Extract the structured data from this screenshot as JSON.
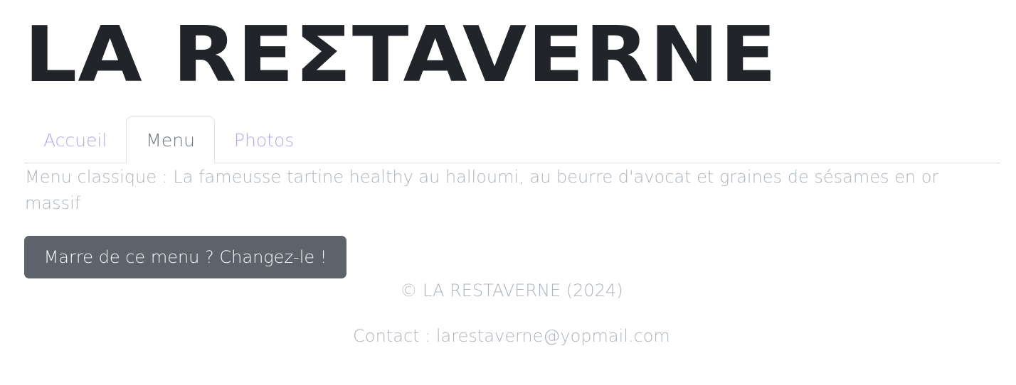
{
  "header": {
    "title": "LA REΣTAVERNE"
  },
  "tabs": [
    {
      "label": "Accueil",
      "active": false
    },
    {
      "label": "Menu",
      "active": true
    },
    {
      "label": "Photos",
      "active": false
    }
  ],
  "main": {
    "menu_text": "Menu classique : La fameusse tartine healthy au halloumi, au beurre d'avocat et graines de sésames en or massif",
    "change_button_label": "Marre de ce menu ? Changez-le !"
  },
  "footer": {
    "copyright": "© LA RESTAVERNE (2024)",
    "contact": "Contact : larestaverne@yopmail.com"
  },
  "colors": {
    "tab_link": "#b7a8f0",
    "tab_active": "#6c757d",
    "button_bg": "#5c636a",
    "muted_text": "#adb5bd"
  }
}
